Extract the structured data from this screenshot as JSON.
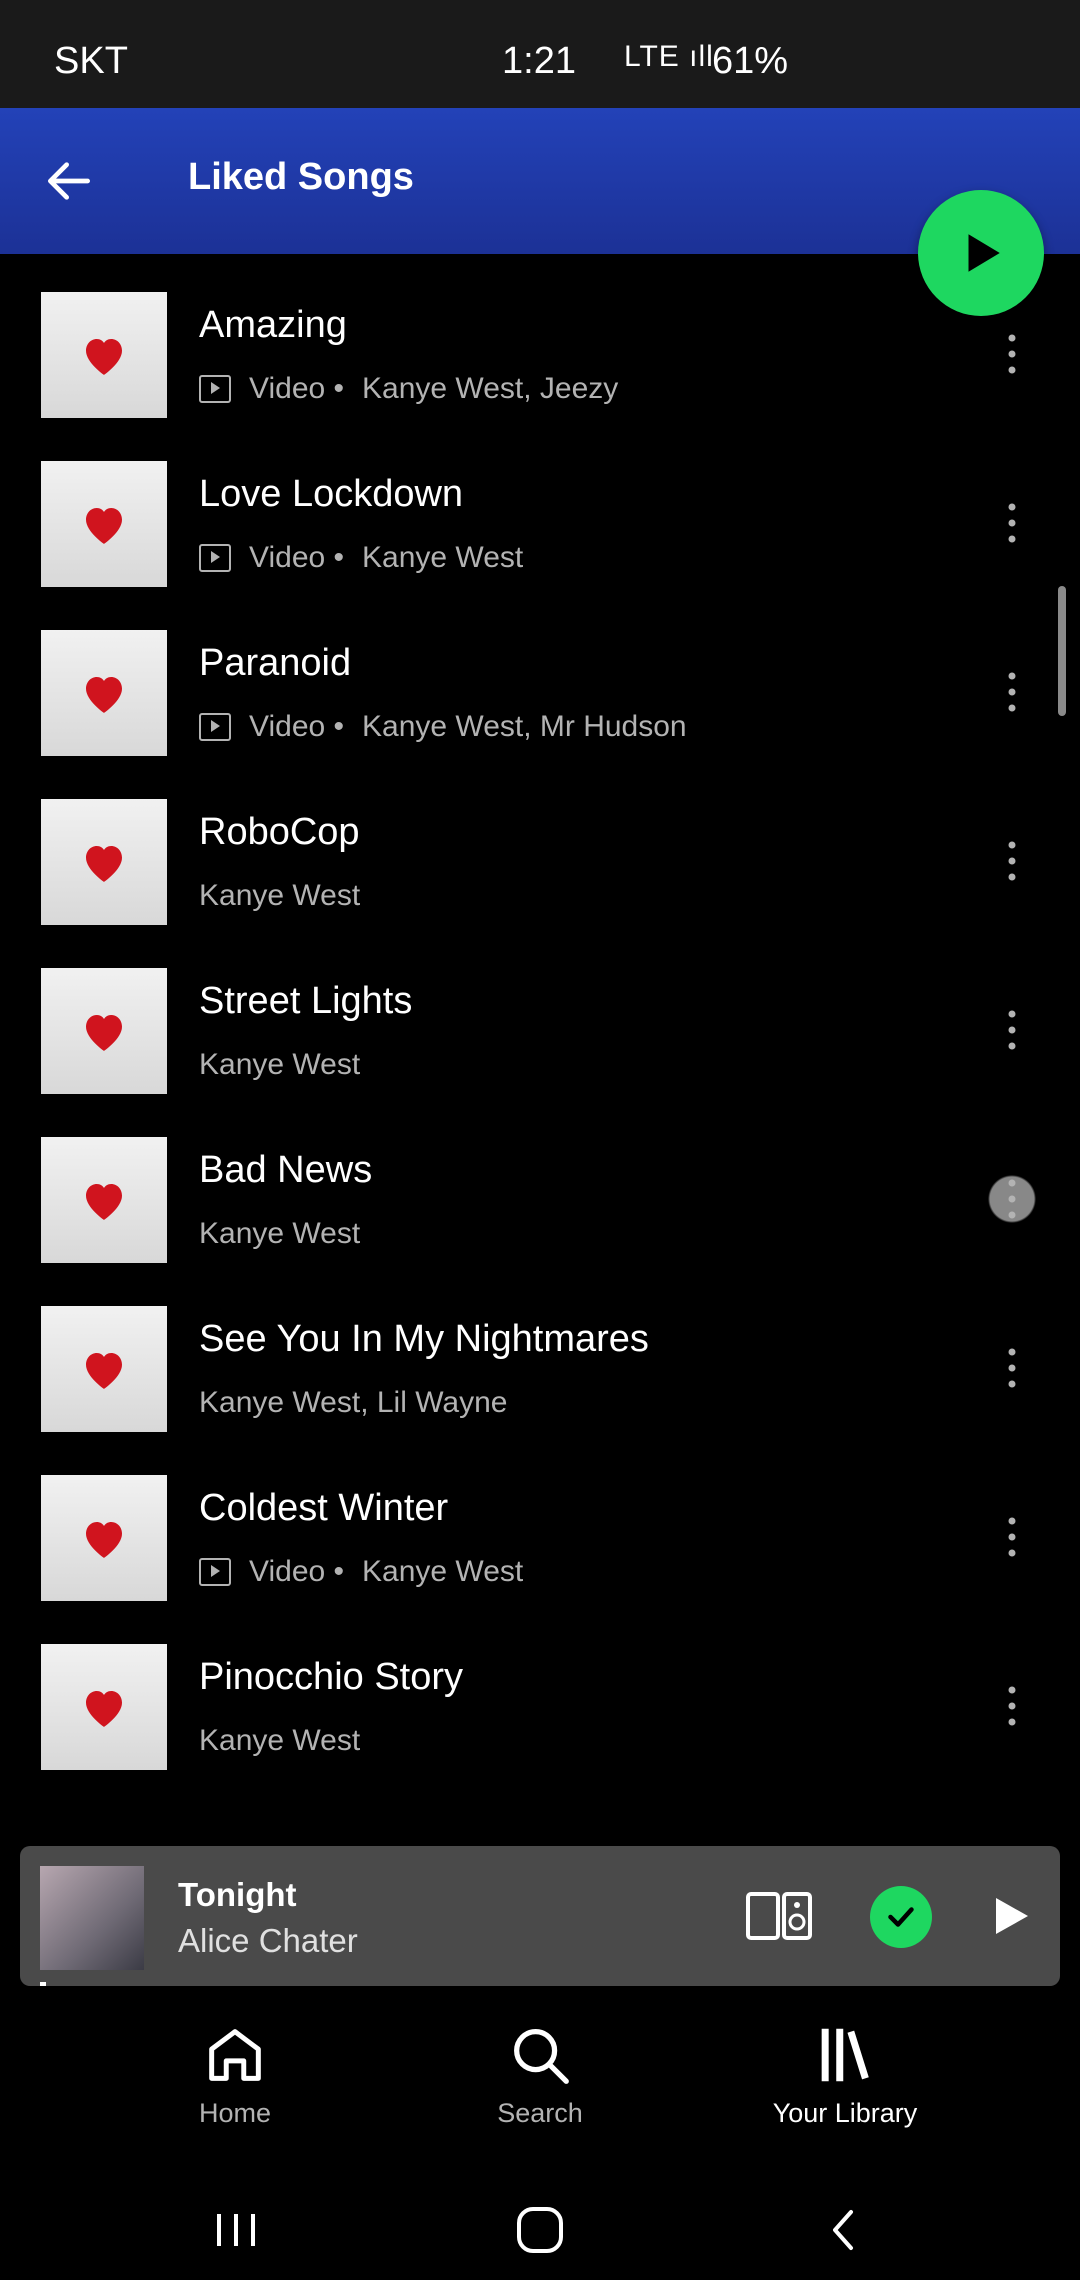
{
  "status_bar": {
    "carrier": "SKT",
    "time": "1:21",
    "network": "LTE ıll",
    "battery": "61%"
  },
  "header": {
    "title": "Liked Songs"
  },
  "songs": [
    {
      "title": "Amazing",
      "subtitle": "Kanye West, Jeezy",
      "video_label": "Video •",
      "is_video": true
    },
    {
      "title": "Love Lockdown",
      "subtitle": "Kanye West",
      "video_label": "Video •",
      "is_video": true
    },
    {
      "title": "Paranoid",
      "subtitle": "Kanye West, Mr Hudson",
      "video_label": "Video •",
      "is_video": true
    },
    {
      "title": "RoboCop",
      "subtitle": "Kanye West",
      "is_video": false
    },
    {
      "title": "Street Lights",
      "subtitle": "Kanye West",
      "is_video": false
    },
    {
      "title": "Bad News",
      "subtitle": "Kanye West",
      "is_video": false
    },
    {
      "title": "See You In My Nightmares",
      "subtitle": "Kanye West, Lil Wayne",
      "is_video": false
    },
    {
      "title": "Coldest Winter",
      "subtitle": "Kanye West",
      "video_label": "Video •",
      "is_video": true
    },
    {
      "title": "Pinocchio Story",
      "subtitle": "Kanye West",
      "is_video": false
    }
  ],
  "now_playing": {
    "title": "Tonight",
    "artist": "Alice Chater"
  },
  "bottom_nav": [
    {
      "label": "Home",
      "icon": "home-icon",
      "active": false
    },
    {
      "label": "Search",
      "icon": "search-icon",
      "active": false
    },
    {
      "label": "Your Library",
      "icon": "library-icon",
      "active": true
    }
  ],
  "colors": {
    "accent": "#1ed760",
    "header": "#2342b8",
    "heart": "#d0141e"
  }
}
